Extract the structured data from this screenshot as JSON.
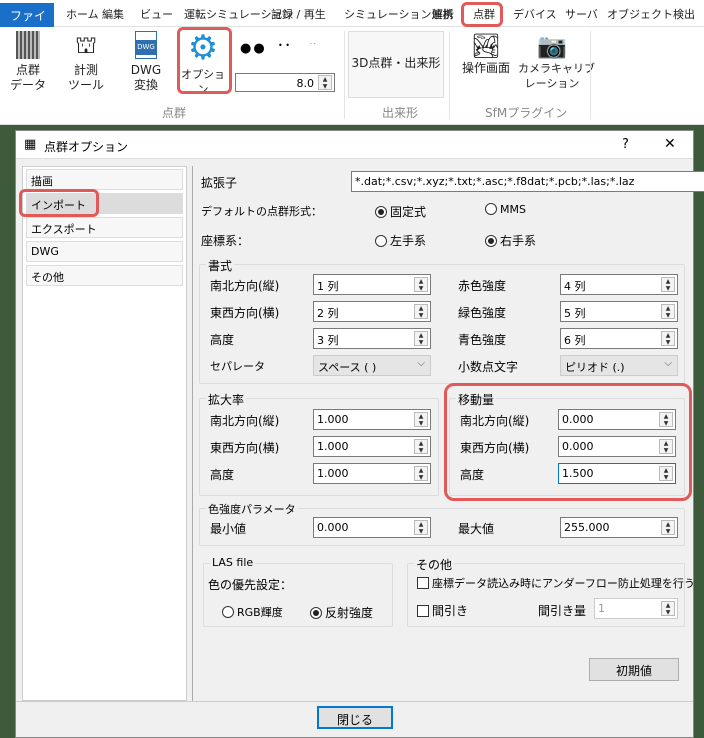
{
  "menubar": {
    "file": "ファイル",
    "items": [
      "ホーム",
      "編集",
      "ビュー",
      "運転シミュレーション",
      "記録 / 再生",
      "シミュレーション連携",
      "解析",
      "点群",
      "デバイス",
      "サーバ",
      "オブジェクト検出"
    ]
  },
  "ribbon": {
    "pointcloud_data": "点群\nデータ",
    "measure_tool": "計測\nツール",
    "dwg_convert": "DWG\n変換",
    "dwg_icon_text": "DWG",
    "option": "オプション",
    "point_size": "8.0",
    "group_pointcloud": "点群",
    "dekigata_button": "3D点群・出来形",
    "group_dekigata": "出来形",
    "operation_screen": "操作画面",
    "camera_calibration": "カメラキャリブ\nレーション",
    "group_sfm": "SfMプラグイン"
  },
  "dialog": {
    "title": "点群オプション",
    "help": "?",
    "close_x": "✕",
    "tabs": [
      "描画",
      "インポート",
      "エクスポート",
      "DWG",
      "その他"
    ],
    "selected_tab": "インポート",
    "extension_label": "拡張子",
    "extension_value": "*.dat;*.csv;*.xyz;*.txt;*.asc;*.f8dat;*.pcb;*.las;*.laz",
    "default_format_label": "デフォルトの点群形式：",
    "format_fixed": "固定式",
    "format_mms": "MMS",
    "format_selected": "固定式",
    "coord_label": "座標系：",
    "coord_left": "左手系",
    "coord_right": "右手系",
    "coord_selected": "右手系",
    "format_group": {
      "title": "書式",
      "ns_label": "南北方向(縦)",
      "ns_value": "1 列",
      "ew_label": "東西方向(横)",
      "ew_value": "2 列",
      "h_label": "高度",
      "h_value": "3 列",
      "r_label": "赤色強度",
      "r_value": "4 列",
      "g_label": "緑色強度",
      "g_value": "5 列",
      "b_label": "青色強度",
      "b_value": "6 列",
      "sep_label": "セパレータ",
      "sep_value": "スペース ( )",
      "dec_label": "小数点文字",
      "dec_value": "ピリオド (.)"
    },
    "scale_group": {
      "title": "拡大率",
      "ns_label": "南北方向(縦)",
      "ns_value": "1.000",
      "ew_label": "東西方向(横)",
      "ew_value": "1.000",
      "h_label": "高度",
      "h_value": "1.000"
    },
    "offset_group": {
      "title": "移動量",
      "ns_label": "南北方向(縦)",
      "ns_value": "0.000",
      "ew_label": "東西方向(横)",
      "ew_value": "0.000",
      "h_label": "高度",
      "h_value": "1.500"
    },
    "intensity_group": {
      "title": "色強度パラメータ",
      "min_label": "最小値",
      "min_value": "0.000",
      "max_label": "最大値",
      "max_value": "255.000"
    },
    "las_group": {
      "title": "LAS file",
      "priority_label": "色の優先設定：",
      "rgb": "RGB輝度",
      "reflect": "反射強度",
      "selected": "反射強度"
    },
    "other_group": {
      "title": "その他",
      "underflow": "座標データ読込み時にアンダーフロー防止処理を行う",
      "thin": "間引き",
      "thin_amount_label": "間引き量",
      "thin_amount": "1"
    },
    "reset_button": "初期値",
    "close_button": "閉じる"
  },
  "colors": {
    "accent": "#1a6fc9",
    "highlight": "#e05a5a"
  }
}
